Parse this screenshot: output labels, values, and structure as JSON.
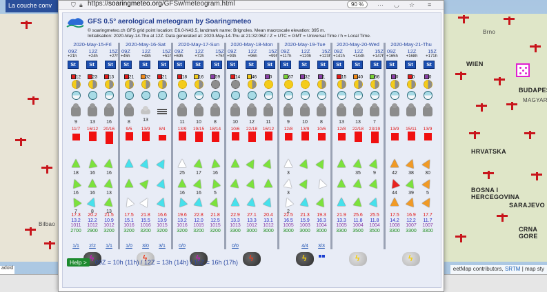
{
  "browser": {
    "url_prefix": "https://",
    "url_host": "soaringmeteo.org",
    "url_path": "/GFSw/meteogram.html",
    "zoom": "90 %"
  },
  "map": {
    "banner": "La couche conv",
    "labels": {
      "brno": "Brno",
      "wien": "WIEN",
      "budapest": "BUDAPEST",
      "magyarorszag": "MAGYARO",
      "hrvatska": "HRVATSKA",
      "bosna": "BOSNA I HERCEGOVINA",
      "sarajevo": "SARAJEVO",
      "crnagora": "CRNA GORE",
      "bilbao": "Bilbao"
    },
    "attribution": {
      "prefix": "eetMap contributors, ",
      "srtm": "SRTM",
      "suffix": " | map sty"
    },
    "bottom_left": "adold"
  },
  "meteogram": {
    "title": "GFS 0.5° aerological meteogram by Soaringmeteo",
    "subtitle1": "© soaringmeteo.ch  GFS grid point location: E6.0-N43.5, landmark name: Brignoles. Mean macroscale elevation: 395 m.",
    "subtitle2": "Initialisation: 2020-May-14-Thu at 12Z. Data generated at: 2020-May-14-Thu at 21:32:06Z / Z = UTC = GMT = Universal Time / h = Local Time.",
    "st_label": "St",
    "days": [
      {
        "title": "2020-May-15-Fri",
        "hours": [
          "09Z",
          "12Z",
          "15Z"
        ],
        "offsets": [
          "+21h",
          "+24h",
          "+27h"
        ],
        "sq": [
          {
            "c": "#e21b1b",
            "n": "12"
          },
          {
            "c": "#e21b1b",
            "n": "23"
          },
          {
            "c": "#e21b1b",
            "n": "13"
          }
        ],
        "sun": [
          "mixed",
          "mixed",
          "mixed"
        ],
        "circ": [
          "half",
          "full",
          "half"
        ],
        "cloud": [
          "dark",
          "dark",
          "dark"
        ],
        "cloud_n": [
          "9",
          "13",
          "16"
        ],
        "temps": [
          "11/7",
          "16/12",
          "20/16"
        ],
        "bars": [
          10,
          14,
          18
        ],
        "w1": [
          {
            "c": "green",
            "r": "0"
          },
          {
            "c": "green",
            "r": "-10"
          },
          {
            "c": "green",
            "r": "10"
          }
        ],
        "w1n": [
          "18",
          "16",
          "16"
        ],
        "w2": [
          {
            "c": "green",
            "r": "-20"
          },
          {
            "c": "green",
            "r": "0"
          },
          {
            "c": "green",
            "r": "10"
          }
        ],
        "w2n": [
          "16",
          "16",
          "13"
        ],
        "w3": [
          {
            "c": "green",
            "r": "-30"
          },
          {
            "c": "cyan",
            "r": "20"
          },
          {
            "c": "green",
            "r": "10"
          }
        ],
        "w3n": [
          "7",
          "8",
          "13"
        ],
        "vals": [
          [
            "17.3",
            "13.2",
            "1011",
            "2700"
          ],
          [
            "20.2",
            "12.2",
            "1012",
            "2900"
          ],
          [
            "21.5",
            "10.9",
            "1012",
            "3200"
          ]
        ],
        "fracs": [
          "1/1",
          "2/2",
          "1/1"
        ],
        "storm": "dark-purple"
      },
      {
        "title": "2020-May-16-Sat",
        "hours": [
          "09Z",
          "12Z",
          "15Z"
        ],
        "offsets": [
          "+45h",
          "+48h",
          "+51h"
        ],
        "sq": [
          {
            "c": "#e21b1b",
            "n": "21"
          },
          {
            "c": "#f08a1a",
            "n": "32"
          },
          {
            "c": "#e21b1b",
            "n": "21"
          }
        ],
        "sun": [
          "mixed",
          "mixed",
          "mixed"
        ],
        "circ": [
          "full",
          "full",
          "full"
        ],
        "cloud": [
          "dark",
          "light",
          "lines"
        ],
        "cloud_n": [
          "8",
          "13",
          ""
        ],
        "temps": [
          "9/5",
          "13/9",
          "8/4"
        ],
        "bars": [
          12,
          14,
          8
        ],
        "w1": [
          {
            "c": "cyan",
            "r": "0"
          },
          {
            "c": "cyan",
            "r": "20"
          },
          {
            "c": "cyan",
            "r": "30"
          }
        ],
        "w1n": [
          "",
          "",
          ""
        ],
        "w2": [
          {
            "c": "green",
            "r": "0"
          },
          {
            "c": "green",
            "r": "40"
          },
          {
            "c": "cyan",
            "r": "20"
          }
        ],
        "w2n": [
          "",
          "",
          ""
        ],
        "w3": [
          {
            "c": "white",
            "r": "-20"
          },
          {
            "c": "white",
            "r": "30"
          },
          {
            "c": "cyan",
            "r": "20"
          }
        ],
        "w3n": [
          "",
          "",
          ""
        ],
        "vals": [
          [
            "17.5",
            "15.1",
            "1016",
            "3200"
          ],
          [
            "21.8",
            "15.5",
            "1016",
            "3200"
          ],
          [
            "16.6",
            "13.9",
            "1015",
            "3200"
          ]
        ],
        "fracs": [
          "1/0",
          "3/0",
          "3/1"
        ],
        "storm": "light-red"
      },
      {
        "title": "2020-May-17-Sun",
        "hours": [
          "09Z",
          "12Z",
          "15Z"
        ],
        "offsets": [
          "+69h",
          "+72h",
          "+75h"
        ],
        "sq": [
          {
            "c": "#e21b1b",
            "n": "18"
          },
          {
            "c": "#f4cc1a",
            "n": "16"
          },
          {
            "c": "#8a3fa6",
            "n": "59"
          }
        ],
        "sun": [
          "full",
          "mixed",
          "gray"
        ],
        "circ": [
          "full",
          "half",
          "full"
        ],
        "cloud": [
          "dark",
          "dark",
          "dark"
        ],
        "cloud_n": [
          "11",
          "10",
          "8"
        ],
        "temps": [
          "13/9",
          "19/15",
          "18/14"
        ],
        "bars": [
          13,
          15,
          15
        ],
        "w1": [
          {
            "c": "white",
            "r": "0"
          },
          {
            "c": "green",
            "r": "10"
          },
          {
            "c": "green",
            "r": "-10"
          }
        ],
        "w1n": [
          "25",
          "17",
          "16"
        ],
        "w2": [
          {
            "c": "green",
            "r": "0"
          },
          {
            "c": "green",
            "r": "20"
          },
          {
            "c": "green",
            "r": "-20"
          }
        ],
        "w2n": [
          "16",
          "16",
          "5"
        ],
        "w3": [
          {
            "c": "cyan",
            "r": "-20"
          },
          {
            "c": "cyan",
            "r": "10"
          },
          {
            "c": "green",
            "r": "20"
          }
        ],
        "w3n": [
          "",
          "",
          ""
        ],
        "vals": [
          [
            "19.6",
            "13.2",
            "1016",
            "3200"
          ],
          [
            "22.8",
            "12.0",
            "1015",
            "3200"
          ],
          [
            "21.8",
            "12.5",
            "1015",
            "3200"
          ]
        ],
        "fracs": [
          "0/0",
          "",
          ""
        ],
        "storm": "dark-purple"
      },
      {
        "title": "2020-May-18-Mon",
        "hours": [
          "09Z",
          "12Z",
          "15Z"
        ],
        "offsets": [
          "+93h",
          "+96h",
          "+99h"
        ],
        "sq": [
          {
            "c": "#e21b1b",
            "n": "14"
          },
          {
            "c": "#f4cc1a",
            "n": "46"
          },
          {
            "c": "#8a3fa6",
            "n": "0"
          }
        ],
        "sun": [
          "gray",
          "mixed",
          "full"
        ],
        "circ": [
          "full",
          "full",
          "half"
        ],
        "cloud": [
          "dark",
          "dark",
          "dark"
        ],
        "cloud_n": [
          "10",
          "12",
          "11"
        ],
        "temps": [
          "10/6",
          "22/18",
          "16/12"
        ],
        "bars": [
          12,
          15,
          13
        ],
        "w1": [
          {
            "c": "green",
            "r": "0"
          },
          {
            "c": "green",
            "r": "30"
          },
          {
            "c": "green",
            "r": "20"
          }
        ],
        "w1n": [
          "",
          "",
          ""
        ],
        "w2": [
          {
            "c": "green",
            "r": "10"
          },
          {
            "c": "green",
            "r": "20"
          },
          {
            "c": "green",
            "r": "0"
          }
        ],
        "w2n": [
          "",
          "",
          ""
        ],
        "w3": [
          {
            "c": "cyan",
            "r": "0"
          },
          {
            "c": "cyan",
            "r": "10"
          },
          {
            "c": "cyan",
            "r": "20"
          }
        ],
        "w3n": [
          "",
          "",
          ""
        ],
        "vals": [
          [
            "22.9",
            "13.3",
            "1013",
            "3300"
          ],
          [
            "27.1",
            "13.3",
            "1012",
            "3000"
          ],
          [
            "20.4",
            "13.1",
            "1012",
            "3000"
          ]
        ],
        "fracs": [
          "0/0",
          "",
          ""
        ],
        "storm": "dark-red"
      },
      {
        "title": "2020-May-19-Tue",
        "hours": [
          "09Z",
          "12Z",
          "15Z"
        ],
        "offsets": [
          "+117h",
          "+120h",
          "+123h"
        ],
        "sq": [
          {
            "c": "#7ad136",
            "n": "67"
          },
          {
            "c": "#8a3fa6",
            "n": "32"
          },
          {
            "c": "#8a3fa6",
            "n": "1"
          }
        ],
        "sun": [
          "full",
          "full",
          "mixed"
        ],
        "circ": [
          "half",
          "half",
          "half"
        ],
        "cloud": [
          "dark",
          "dark",
          "dark"
        ],
        "cloud_n": [
          "9",
          "10",
          "8"
        ],
        "temps": [
          "12/8",
          "13/9",
          "10/6"
        ],
        "bars": [
          11,
          13,
          11
        ],
        "w1": [
          {
            "c": "white",
            "r": "0"
          },
          {
            "c": "green",
            "r": "20"
          },
          {
            "c": "green",
            "r": "30"
          }
        ],
        "w1n": [
          "3",
          "",
          ""
        ],
        "w2": [
          {
            "c": "white",
            "r": "10"
          },
          {
            "c": "green",
            "r": "30"
          },
          {
            "c": "white",
            "r": "-20"
          }
        ],
        "w2n": [
          "3",
          "",
          ""
        ],
        "w3": [
          {
            "c": "white",
            "r": "-20"
          },
          {
            "c": "cyan",
            "r": "10"
          },
          {
            "c": "green",
            "r": "20"
          }
        ],
        "w3n": [
          "2",
          "",
          ""
        ],
        "vals": [
          [
            "22.5",
            "16.5",
            "1005",
            "3000"
          ],
          [
            "21.3",
            "15.9",
            "1003",
            "3000"
          ],
          [
            "19.3",
            "16.3",
            "1004",
            "3000"
          ]
        ],
        "fracs": [
          "",
          "4/4",
          "3/3"
        ],
        "storm": "dark-yellow"
      },
      {
        "title": "2020-May-20-Wed",
        "hours": [
          "09Z",
          "12Z",
          "15Z"
        ],
        "offsets": [
          "+141h",
          "+144h",
          "+147h"
        ],
        "sq": [
          {
            "c": "#e21b1b",
            "n": "15"
          },
          {
            "c": "#f08a1a",
            "n": "40"
          },
          {
            "c": "#7ad136",
            "n": "66"
          }
        ],
        "sun": [
          "mixed",
          "mixed",
          "mixed"
        ],
        "circ": [
          "half",
          "half",
          "half"
        ],
        "cloud": [
          "dark",
          "dark",
          "dark"
        ],
        "cloud_n": [
          "13",
          "13",
          "7"
        ],
        "temps": [
          "12/8",
          "22/18",
          "23/19"
        ],
        "bars": [
          11,
          15,
          17
        ],
        "w1": [
          {
            "c": "green",
            "r": "0"
          },
          {
            "c": "green",
            "r": "10"
          },
          {
            "c": "green",
            "r": "20"
          }
        ],
        "w1n": [
          "",
          "35",
          "9"
        ],
        "w2": [
          {
            "c": "green",
            "r": "0"
          },
          {
            "c": "green",
            "r": "10"
          },
          {
            "c": "green",
            "r": "20"
          }
        ],
        "w2n": [
          "",
          "",
          ""
        ],
        "w3": [
          {
            "c": "cyan",
            "r": "0"
          },
          {
            "c": "green",
            "r": "10"
          },
          {
            "c": "cyan",
            "r": "20"
          }
        ],
        "w3n": [
          "",
          "",
          ""
        ],
        "vals": [
          [
            "21.9",
            "13.3",
            "1005",
            "3300"
          ],
          [
            "25.6",
            "11.8",
            "1004",
            "3500"
          ],
          [
            "25.5",
            "11.8",
            "1004",
            "3500"
          ]
        ],
        "fracs": [
          "",
          "",
          ""
        ],
        "storm": "light-orange"
      },
      {
        "title": "2020-May-21-Thu",
        "hours": [
          "09Z",
          "12Z",
          "15Z"
        ],
        "offsets": [
          "+165h",
          "+168h",
          "+171h"
        ],
        "sq": [
          {
            "c": "#8a3fa6",
            "n": "0"
          },
          {
            "c": "#e21b1b",
            "n": "0"
          },
          {
            "c": "#8a3fa6",
            "n": "0"
          }
        ],
        "sun": [
          "mixed",
          "mixed",
          "mixed"
        ],
        "circ": [
          "half",
          "half",
          "half"
        ],
        "cloud": [
          "dark",
          "dark",
          "dark"
        ],
        "cloud_n": [
          "",
          "",
          ""
        ],
        "temps": [
          "13/9",
          "15/11",
          "13/9"
        ],
        "bars": [
          11,
          13,
          11
        ],
        "w1": [
          {
            "c": "orange",
            "r": "0"
          },
          {
            "c": "orange",
            "r": "20"
          },
          {
            "c": "orange",
            "r": "30"
          }
        ],
        "w1n": [
          "42",
          "38",
          "30"
        ],
        "w2": [
          {
            "c": "red",
            "r": "-20"
          },
          {
            "c": "green",
            "r": "20"
          },
          {
            "c": "orange",
            "r": "30"
          }
        ],
        "w2n": [
          "44",
          "39",
          "5"
        ],
        "w3": [
          {
            "c": "orange",
            "r": "0"
          },
          {
            "c": "orange",
            "r": "20"
          },
          {
            "c": "orange",
            "r": "30"
          }
        ],
        "w3n": [
          "",
          "",
          ""
        ],
        "vals": [
          [
            "17.5",
            "14.2",
            "1008",
            "3300"
          ],
          [
            "16.9",
            "12.2",
            "1007",
            "3300"
          ],
          [
            "17.7",
            "11.7",
            "1007",
            "3300"
          ]
        ],
        "fracs": [
          "",
          "",
          ""
        ],
        "storm": "light-yellow"
      }
    ],
    "help_label": "Help >",
    "footer_text": "09Z = 10h (11h)   /  12Z = 13h (14h)  /  15Z = 16h (17h)"
  }
}
